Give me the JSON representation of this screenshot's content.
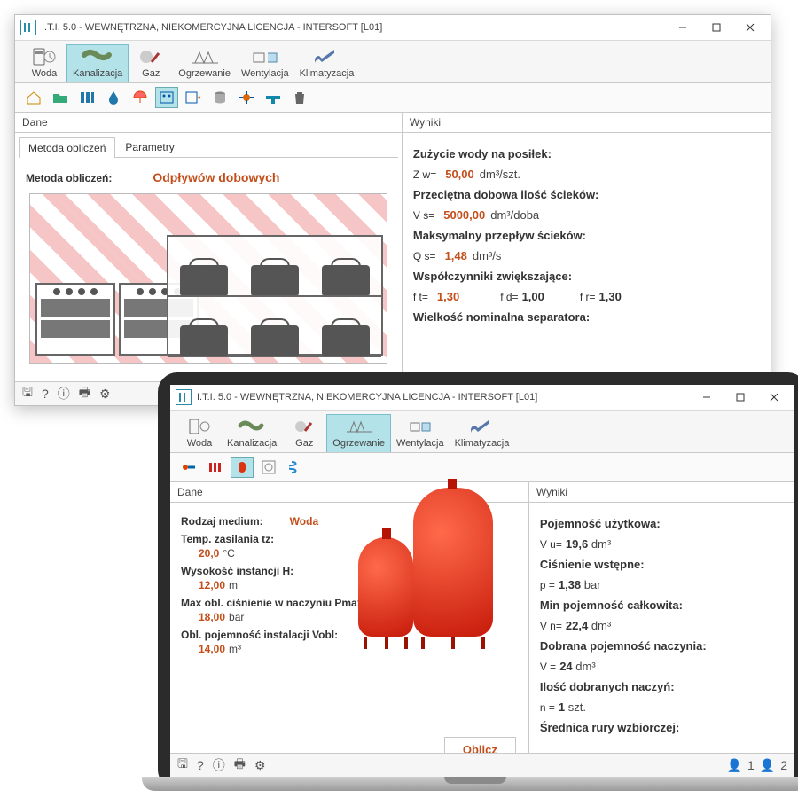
{
  "window1": {
    "title": "I.T.I. 5.0 - WEWNĘTRZNA, NIEKOMERCYJNA LICENCJA - INTERSOFT [L01]",
    "tabs": [
      "Woda",
      "Kanalizacja",
      "Gaz",
      "Ogrzewanie",
      "Wentylacja",
      "Klimatyzacja"
    ],
    "active_tab": "Kanalizacja",
    "panel_left_title": "Dane",
    "panel_right_title": "Wyniki",
    "subtabs": [
      "Metoda obliczeń",
      "Parametry"
    ],
    "method_label": "Metoda obliczeń:",
    "method_value": "Odpływów dobowych",
    "results": {
      "r1_label": "Zużycie wody na posiłek:",
      "r1_sym": "Z w=",
      "r1_val": "50,00",
      "r1_unit": "dm³/szt.",
      "r2_label": "Przeciętna dobowa ilość ścieków:",
      "r2_sym": "V s=",
      "r2_val": "5000,00",
      "r2_unit": "dm³/doba",
      "r3_label": "Maksymalny przepływ ścieków:",
      "r3_sym": "Q s=",
      "r3_val": "1,48",
      "r3_unit": "dm³/s",
      "r4_label": "Współczynniki zwiększające:",
      "ft_sym": "f t=",
      "ft_val": "1,30",
      "fd_sym": "f d=",
      "fd_val": "1,00",
      "fr_sym": "f r=",
      "fr_val": "1,30",
      "r5_label": "Wielkość nominalna separatora:"
    }
  },
  "window2": {
    "title": "I.T.I. 5.0 - WEWNĘTRZNA, NIEKOMERCYJNA LICENCJA - INTERSOFT [L01]",
    "tabs": [
      "Woda",
      "Kanalizacja",
      "Gaz",
      "Ogrzewanie",
      "Wentylacja",
      "Klimatyzacja"
    ],
    "active_tab": "Ogrzewanie",
    "panel_left_title": "Dane",
    "panel_right_title": "Wyniki",
    "dane": {
      "medium_label": "Rodzaj medium:",
      "medium_value": "Woda",
      "tz_label": "Temp. zasilania tz:",
      "tz_val": "20,0",
      "tz_unit": "°C",
      "h_label": "Wysokość instancji H:",
      "h_val": "12,00",
      "h_unit": "m",
      "pmax_label": "Max obl. ciśnienie w naczyniu Pmax:",
      "pmax_val": "18,00",
      "pmax_unit": "bar",
      "vobl_label": "Obl. pojemność instalacji Vobl:",
      "vobl_val": "14,00",
      "vobl_unit": "m³"
    },
    "wyniki": {
      "vu_label": "Pojemność użytkowa:",
      "vu_sym": "V u=",
      "vu_val": "19,6",
      "vu_unit": "dm³",
      "p_label": "Ciśnienie wstępne:",
      "p_sym": "p =",
      "p_val": "1,38",
      "p_unit": "bar",
      "vn_label": "Min pojemność całkowita:",
      "vn_sym": "V n=",
      "vn_val": "22,4",
      "vn_unit": "dm³",
      "v_label": "Dobrana pojemność naczynia:",
      "v_sym": "V =",
      "v_val": "24",
      "v_unit": "dm³",
      "n_label": "Ilość dobranych naczyń:",
      "n_sym": "n =",
      "n_val": "1",
      "n_unit": "szt.",
      "sr_label": "Średnica rury wzbiorczej:"
    },
    "oblicz": "Oblicz",
    "status_right": {
      "a": "1",
      "b": "2"
    }
  }
}
